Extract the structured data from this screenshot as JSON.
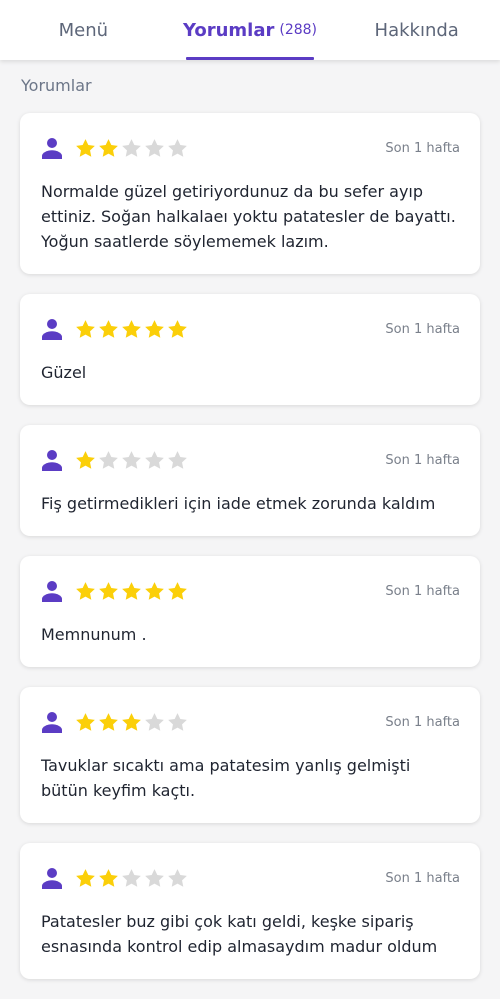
{
  "tabs": {
    "menu": "Menü",
    "reviews": "Yorumlar",
    "reviews_count": "(288)",
    "about": "Hakkında"
  },
  "section_title": "Yorumlar",
  "colors": {
    "accent": "#5b3cc4",
    "star_filled": "#fbcf09",
    "star_empty": "#d9d9d9"
  },
  "reviews": [
    {
      "rating": 2,
      "max_rating": 5,
      "date": "Son 1 hafta",
      "text": "Normalde güzel getiriyordunuz da bu sefer ayıp ettiniz. Soğan halkalaeı yoktu patatesler de bayattı. Yoğun saatlerde söylememek lazım."
    },
    {
      "rating": 5,
      "max_rating": 5,
      "date": "Son 1 hafta",
      "text": "Güzel"
    },
    {
      "rating": 1,
      "max_rating": 5,
      "date": "Son 1 hafta",
      "text": "Fiş getirmedikleri için iade etmek zorunda kaldım"
    },
    {
      "rating": 5,
      "max_rating": 5,
      "date": "Son 1 hafta",
      "text": "Memnunum ."
    },
    {
      "rating": 3,
      "max_rating": 5,
      "date": "Son 1 hafta",
      "text": "Tavuklar sıcaktı ama patatesim yanlış gelmişti bütün keyfim kaçtı."
    },
    {
      "rating": 2,
      "max_rating": 5,
      "date": "Son 1 hafta",
      "text": "Patatesler buz gibi çok katı geldi, keşke sipariş esnasında kontrol edip almasaydım madur oldum"
    }
  ]
}
